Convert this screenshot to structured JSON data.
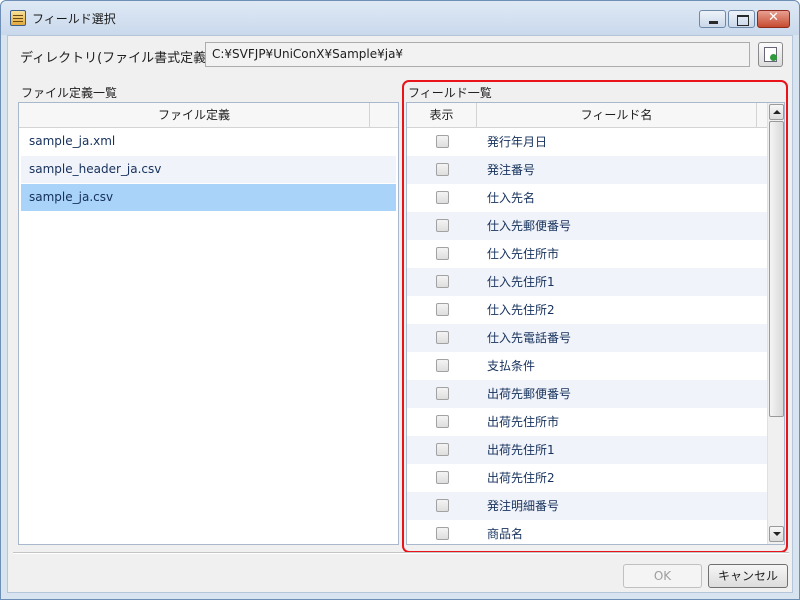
{
  "window": {
    "title": "フィールド選択"
  },
  "directory": {
    "label": "ディレクトリ(ファイル書式定義)",
    "value": "C:¥SVFJP¥UniConX¥Sample¥ja¥"
  },
  "file_list": {
    "section_label": "ファイル定義一覧",
    "column_header": "ファイル定義",
    "items": [
      "sample_ja.xml",
      "sample_header_ja.csv",
      "sample_ja.csv"
    ],
    "selected_index": 2
  },
  "field_list": {
    "section_label": "フィールド一覧",
    "column_show": "表示",
    "column_name": "フィールド名",
    "rows": [
      {
        "name": "発行年月日",
        "checked": false
      },
      {
        "name": "発注番号",
        "checked": false
      },
      {
        "name": "仕入先名",
        "checked": false
      },
      {
        "name": "仕入先郵便番号",
        "checked": false
      },
      {
        "name": "仕入先住所市",
        "checked": false
      },
      {
        "name": "仕入先住所1",
        "checked": false
      },
      {
        "name": "仕入先住所2",
        "checked": false
      },
      {
        "name": "仕入先電話番号",
        "checked": false
      },
      {
        "name": "支払条件",
        "checked": false
      },
      {
        "name": "出荷先郵便番号",
        "checked": false
      },
      {
        "name": "出荷先住所市",
        "checked": false
      },
      {
        "name": "出荷先住所1",
        "checked": false
      },
      {
        "name": "出荷先住所2",
        "checked": false
      },
      {
        "name": "発注明細番号",
        "checked": false
      },
      {
        "name": "商品名",
        "checked": false
      }
    ]
  },
  "buttons": {
    "ok": "OK",
    "cancel": "キャンセル"
  },
  "colors": {
    "highlight_frame": "#e8141a",
    "selection": "#a9d3f8"
  },
  "icons": {
    "app": "table-icon",
    "browse": "browse-folder-icon"
  }
}
